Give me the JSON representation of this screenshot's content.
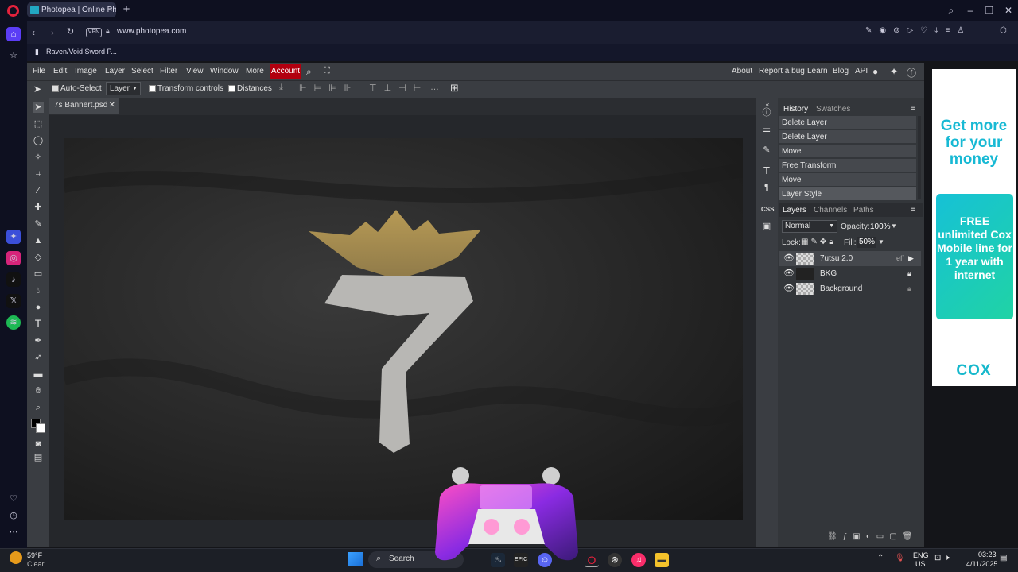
{
  "browser": {
    "tab_title": "Photopea | Online Photo E",
    "url": "www.photopea.com",
    "vpn_label": "VPN",
    "bookmark": "Raven/Void Sword P..."
  },
  "photopea": {
    "menu": [
      "File",
      "Edit",
      "Image",
      "Layer",
      "Select",
      "Filter",
      "View",
      "Window",
      "More"
    ],
    "account": "Account",
    "right_menu": [
      "About",
      "Report a bug",
      "Learn",
      "Blog",
      "API"
    ],
    "options": {
      "auto_select": "Auto-Select",
      "layer_select": "Layer",
      "transform_controls": "Transform controls",
      "distances": "Distances"
    },
    "document_tab": "7s Bannert.psd",
    "history": {
      "tabs": [
        "History",
        "Swatches"
      ],
      "items": [
        "Delete Layer",
        "Delete Layer",
        "Move",
        "Free Transform",
        "Move",
        "Layer Style"
      ]
    },
    "layers": {
      "tabs": [
        "Layers",
        "Channels",
        "Paths"
      ],
      "blend_mode": "Normal",
      "opacity_label": "Opacity:",
      "opacity": "100%",
      "lock_label": "Lock:",
      "fill_label": "Fill:",
      "fill": "50%",
      "items": [
        {
          "name": "7utsu 2.0",
          "fx": "eff"
        },
        {
          "name": "BKG",
          "fx": ""
        },
        {
          "name": "Background",
          "fx": ""
        }
      ]
    }
  },
  "ad": {
    "headline": "Get more for your money",
    "offer": "FREE unlimited Cox Mobile line for 1 year with internet",
    "brand": "COX"
  },
  "taskbar": {
    "weather_temp": "59°F",
    "weather_desc": "Clear",
    "search": "Search",
    "lang": "ENG",
    "region": "US",
    "time": "03:23",
    "date": "4/11/2025"
  },
  "colors": {
    "accent": "#b2000f",
    "panel": "#3a3d42",
    "ad_cyan": "#17b9d4"
  }
}
